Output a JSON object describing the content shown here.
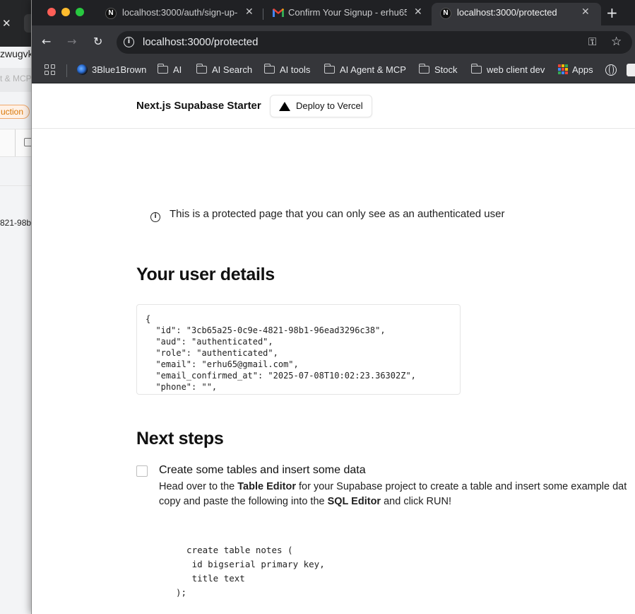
{
  "background_window": {
    "title_fragment": "zwugvk",
    "tools_fragment": "t & MCP",
    "badge_fragment": "uction",
    "cell_fragment": "821-98b"
  },
  "tabs": [
    {
      "title": "localhost:3000/auth/sign-up-",
      "icon": "nextjs-icon"
    },
    {
      "title": "Confirm Your Signup - erhu65",
      "icon": "gmail-icon"
    },
    {
      "title": "localhost:3000/protected",
      "icon": "nextjs-icon",
      "active": true
    }
  ],
  "address_bar": {
    "url": "localhost:3000/protected"
  },
  "bookmarks": [
    {
      "label": "3Blue1Brown",
      "icon": "site-icon"
    },
    {
      "label": "AI",
      "icon": "folder-icon"
    },
    {
      "label": "AI Search",
      "icon": "folder-icon"
    },
    {
      "label": "AI tools",
      "icon": "folder-icon"
    },
    {
      "label": "AI Agent & MCP",
      "icon": "folder-icon"
    },
    {
      "label": "Stock",
      "icon": "folder-icon"
    },
    {
      "label": "web client dev",
      "icon": "folder-icon"
    },
    {
      "label": "Apps",
      "icon": "apps-icon"
    }
  ],
  "site": {
    "brand": "Next.js Supabase Starter",
    "deploy_label": "Deploy to Vercel"
  },
  "notice": "This is a protected page that you can only see as an authenticated user",
  "user_details": {
    "heading": "Your user details",
    "json_lines": [
      "{",
      "  \"id\": \"3cb65a25-0c9e-4821-98b1-96ead3296c38\",",
      "  \"aud\": \"authenticated\",",
      "  \"role\": \"authenticated\",",
      "  \"email\": \"erhu65@gmail.com\",",
      "  \"email_confirmed_at\": \"2025-07-08T10:02:23.36302Z\",",
      "  \"phone\": \"\","
    ]
  },
  "next_steps": {
    "heading": "Next steps",
    "step1": {
      "title": "Create some tables and insert some data",
      "line1_a": "Head over to the ",
      "line1_b": "Table Editor",
      "line1_c": " for your Supabase project to create a table and insert some example dat",
      "line2_a": "copy and paste the following into the ",
      "line2_b": "SQL Editor",
      "line2_c": " and click RUN!"
    },
    "sql_lines": [
      "  create table notes (",
      "   id bigserial primary key,",
      "   title text",
      ");"
    ]
  },
  "colors": {
    "tab_strip": "#202124",
    "toolbar": "#35363a",
    "badge_orange": "#d97706"
  }
}
